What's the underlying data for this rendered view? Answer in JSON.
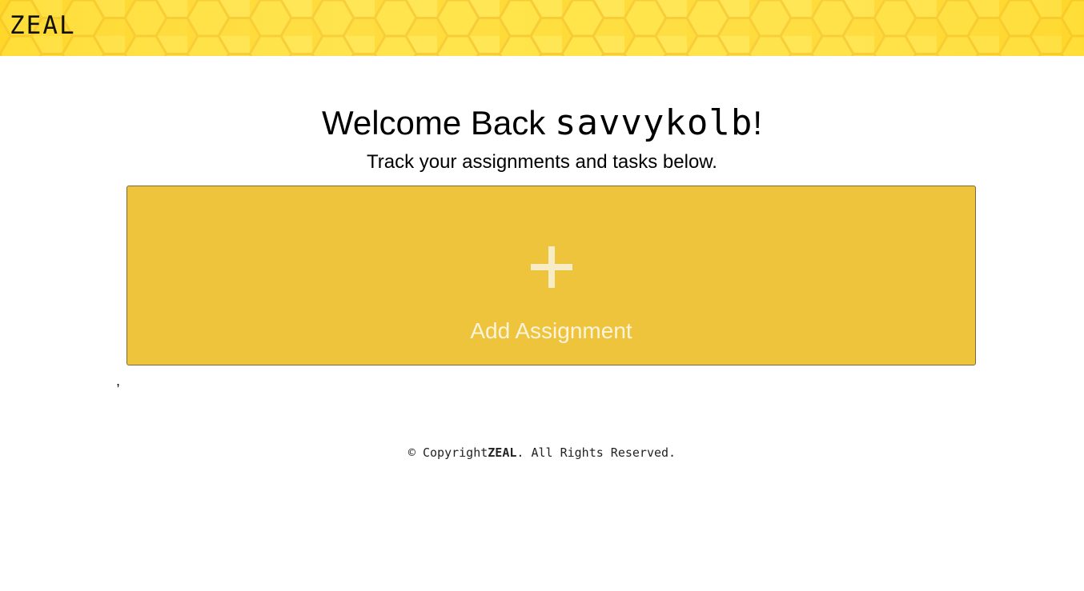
{
  "header": {
    "logo": "ZEAL",
    "background_color": "#ffd92e"
  },
  "main": {
    "welcome_prefix": "Welcome Back ",
    "username": "savvykolb",
    "welcome_suffix": "!",
    "subtitle": "Track your assignments and tasks below.",
    "add_card": {
      "icon": "plus-icon",
      "label": "Add Assignment",
      "background_color": "#eec43c"
    },
    "stray_text": ","
  },
  "footer": {
    "copyright_prefix": "© Copyright",
    "brand": "ZEAL",
    "copyright_suffix": ". All Rights Reserved."
  }
}
